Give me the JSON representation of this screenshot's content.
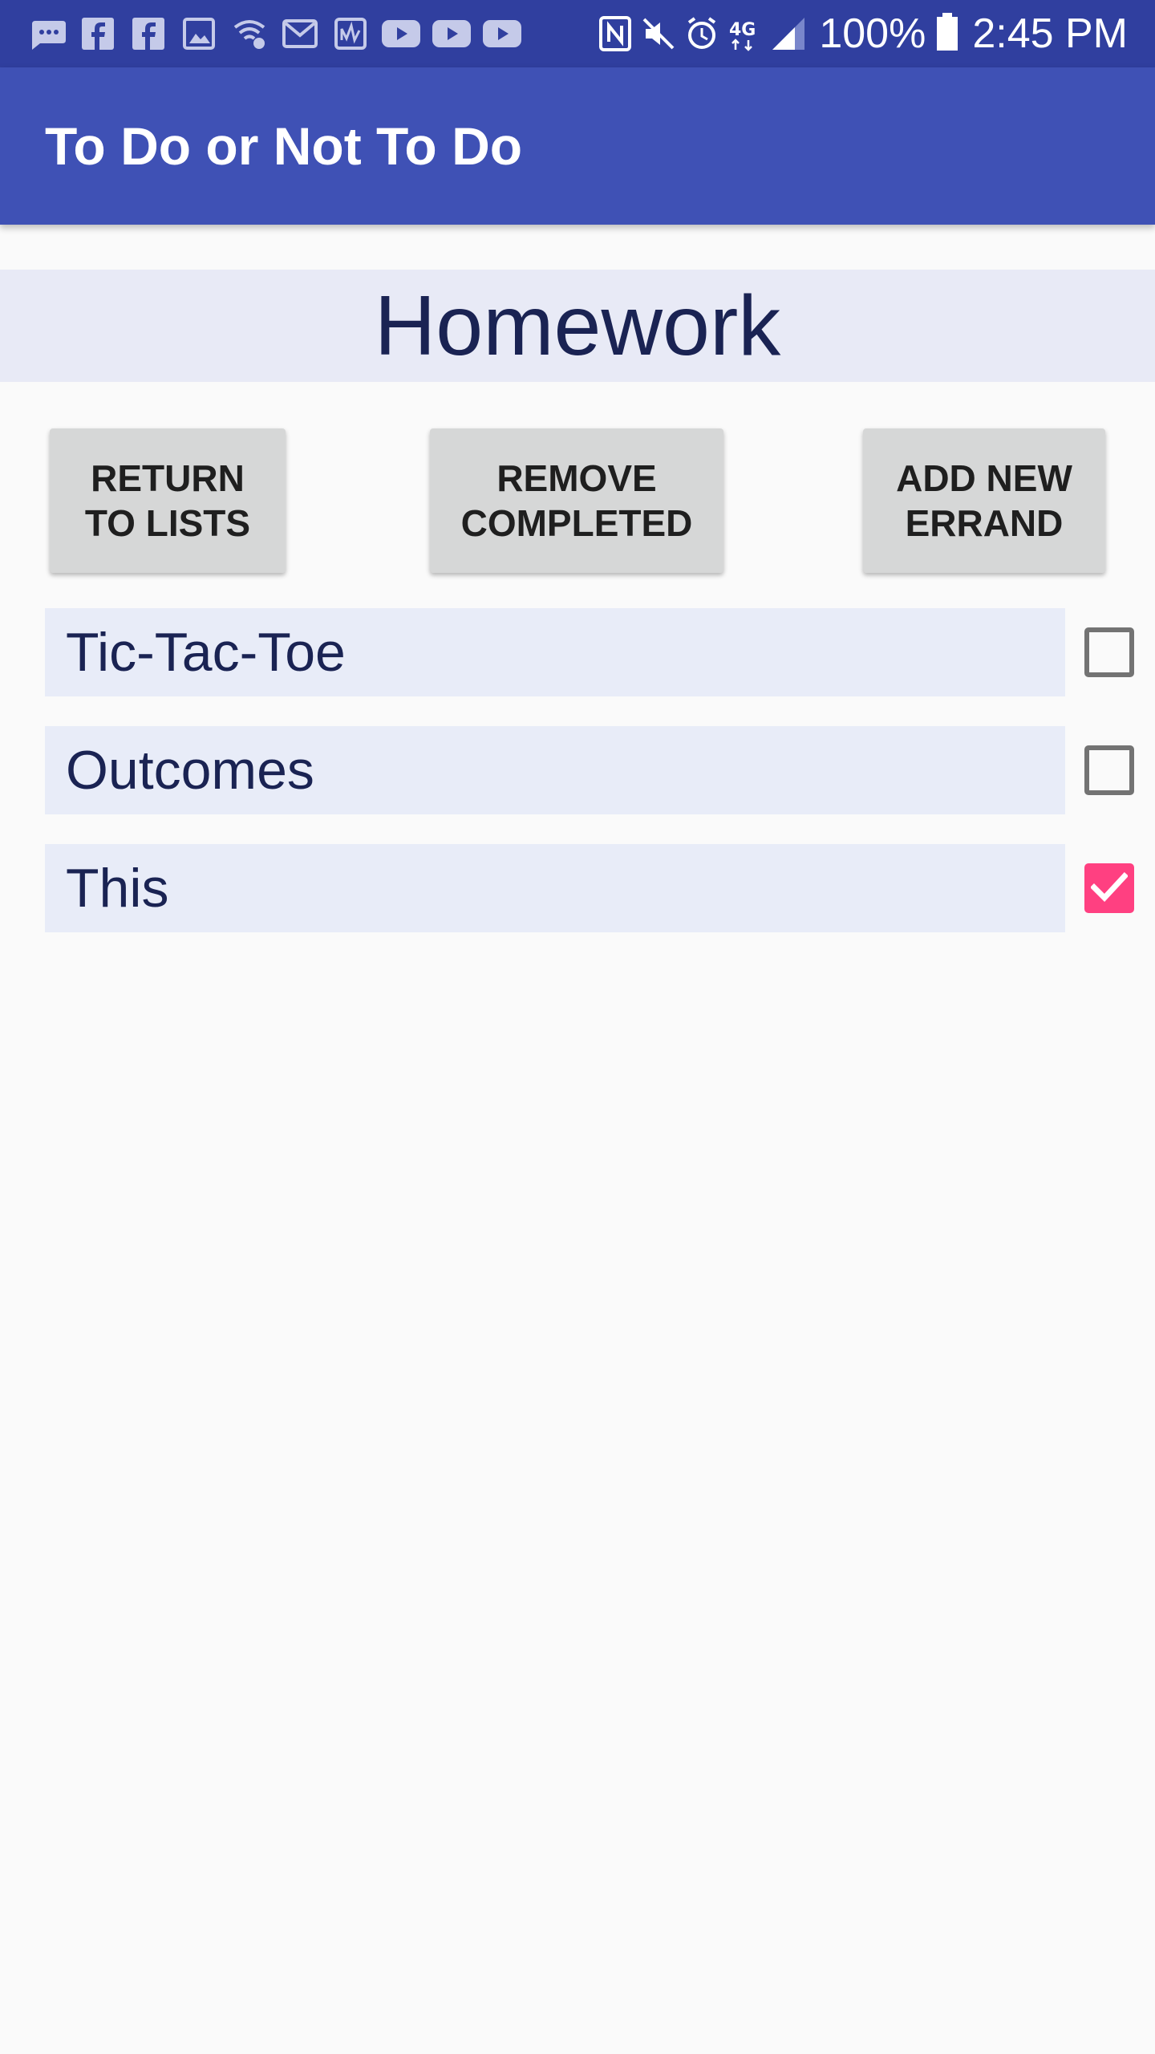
{
  "status_bar": {
    "left_icons": [
      "messages-icon",
      "facebook-icon",
      "facebook-icon",
      "gallery-icon",
      "wifi-calling-icon",
      "gmail-icon",
      "sensor-icon",
      "youtube-icon",
      "youtube-icon",
      "youtube-icon"
    ],
    "right_icons": [
      "nfc-icon",
      "mute-icon",
      "alarm-icon",
      "4g-lte-icon",
      "signal-icon"
    ],
    "battery_percent": "100%",
    "time": "2:45 PM"
  },
  "app_bar": {
    "title": "To Do or Not To Do",
    "color": "#3f51b5"
  },
  "list": {
    "title": "Homework"
  },
  "buttons": {
    "return_label": "RETURN\nTO LISTS",
    "remove_label": "REMOVE\nCOMPLETED",
    "add_label": "ADD NEW\nERRAND"
  },
  "errands": [
    {
      "text": "Tic-Tac-Toe",
      "checked": false
    },
    {
      "text": "Outcomes",
      "checked": false
    },
    {
      "text": "This",
      "checked": true
    }
  ],
  "colors": {
    "status_bar": "#303f9f",
    "accent": "#ff4081",
    "row_background": "#e8ecf8"
  }
}
